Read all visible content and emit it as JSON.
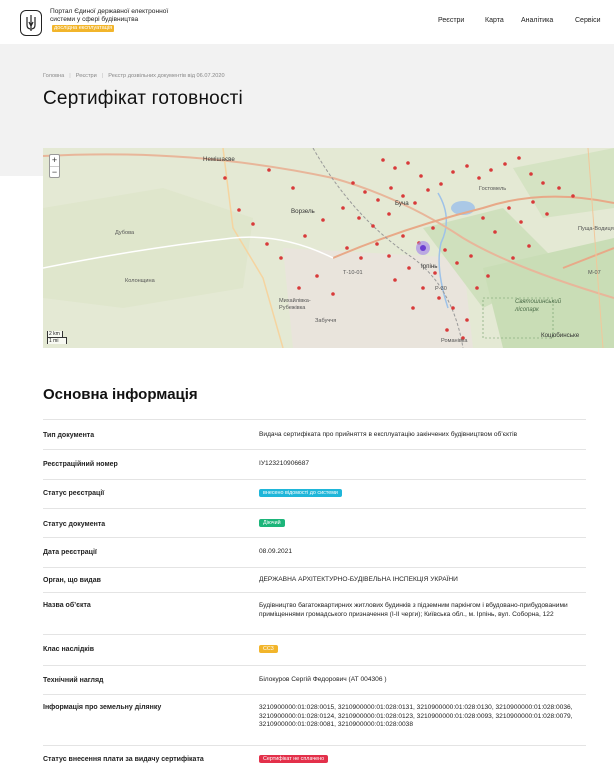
{
  "header": {
    "portal_title": "Портал Єдиної державної електронної системи у сфері будівництва",
    "beta_label": "дослідна експлуатація",
    "nav": [
      "Реєстри",
      "Карта",
      "Аналітика",
      "Сервіси"
    ]
  },
  "breadcrumb": [
    "Головна",
    "Реєстри",
    "Реєстр дозвільних документів від 06.07.2020"
  ],
  "page_title": "Сертифікат готовності",
  "map": {
    "zoom_in": "+",
    "zoom_out": "−",
    "scale": [
      "2 km",
      "1 mi"
    ],
    "labels": [
      "Немішаєве",
      "Ворзель",
      "Буча",
      "Ірпінь",
      "Гостомель",
      "Дубова",
      "Колонщина",
      "Михайлівка-Рубежівка",
      "Забуччя",
      "Святошинський лісопарк",
      "Коцюбинське",
      "Романівка",
      "Т-10-01",
      "М-07",
      "Р-30",
      "Пуща-Водиця"
    ]
  },
  "section_title": "Основна інформація",
  "rows": [
    {
      "key": "Тип документа",
      "value": "Видача сертифіката про прийняття в експлуатацію закінчених будівництвом об’єктів",
      "badge": null
    },
    {
      "key": "Реєстраційний номер",
      "value": "IУ123210906687",
      "badge": null
    },
    {
      "key": "Статус реєстрації",
      "value": "внесено відомості до системи",
      "badge": "cyan"
    },
    {
      "key": "Статус документа",
      "value": "Діючий",
      "badge": "green"
    },
    {
      "key": "Дата реєстрації",
      "value": "08.09.2021",
      "badge": null
    },
    {
      "key": "Орган, що видав",
      "value": "ДЕРЖАВНА АРХІТЕКТУРНО-БУДІВЕЛЬНА ІНСПЕКЦІЯ УКРАЇНИ",
      "badge": null
    },
    {
      "key": "Назва об’єкта",
      "value": "Будівництво багатоквартирних житлових будинків з підземним паркінгом і вбудовано-прибудованими приміщеннями громадського призначення (I-II черги); Київська обл., м. Ірпінь, вул. Соборна, 122",
      "badge": null
    },
    {
      "key": "Клас наслідків",
      "value": "СС3",
      "badge": "yellow"
    },
    {
      "key": "Технічний нагляд",
      "value": "Білокуров Сергій Федорович (АТ 004306 )",
      "badge": null
    },
    {
      "key": "Інформація про земельну ділянку",
      "value": "3210900000:01:028:0015, 3210900000:01:028:0131, 3210900000:01:028:0130, 3210900000:01:028:0036, 3210900000:01:028:0124, 3210900000:01:028:0123, 3210900000:01:028:0093, 3210900000:01:028:0079, 3210900000:01:028:0081, 3210900000:01:028:0038",
      "badge": null
    },
    {
      "key": "Статус внесення плати за видачу сертифіката",
      "value": "Сертифікат не сплачено",
      "badge": "red"
    }
  ]
}
